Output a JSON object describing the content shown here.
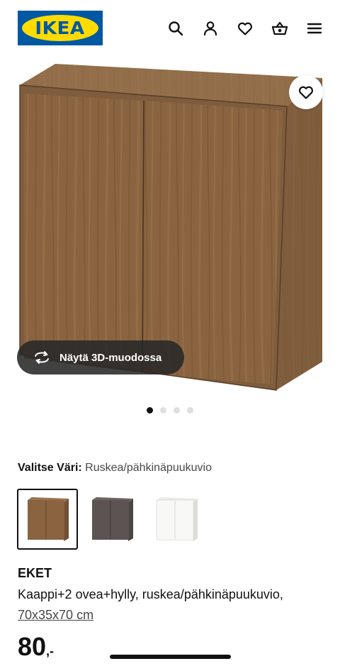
{
  "header": {
    "logo_text": "IKEA",
    "icons": [
      "search-icon",
      "user-icon",
      "heart-icon",
      "basket-icon",
      "menu-icon"
    ],
    "brand_blue": "#0058a3",
    "brand_yellow": "#ffdb00"
  },
  "gallery": {
    "view_3d_label": "Näytä 3D-muodossa",
    "image_count": 4,
    "active_index": 0
  },
  "color": {
    "label": "Valitse Väri:",
    "selected": "Ruskea/pähkinäpuukuvio",
    "swatches": [
      {
        "name": "brown-walnut",
        "color": "#8a6440",
        "selected": true
      },
      {
        "name": "dark-grey",
        "color": "#5b5453",
        "selected": false
      },
      {
        "name": "white",
        "color": "#f7f7f5",
        "selected": false
      }
    ]
  },
  "product": {
    "name": "EKET",
    "description": "Kaappi+2 ovea+hylly, ruskea/pähkinäpuukuvio,",
    "size": "70x35x70 cm",
    "price": "80",
    "price_suffix": ",-"
  }
}
